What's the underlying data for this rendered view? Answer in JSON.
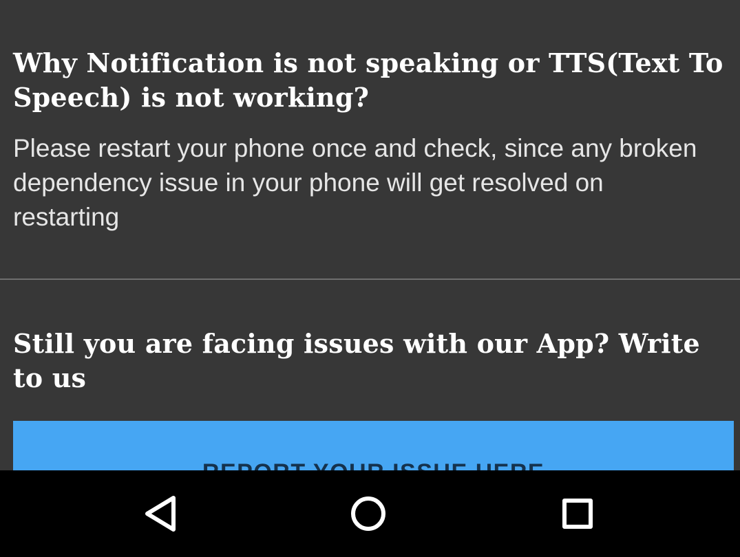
{
  "faq": {
    "question": "Why Notification is not speaking or TTS(Text To Speech) is not working?",
    "answer": "Please restart your phone once and check, since any broken dependency issue in your phone will get resolved on restarting"
  },
  "contact": {
    "heading": "Still you are facing issues with our App? Write to us",
    "button_label": "REPORT YOUR ISSUE HERE"
  },
  "colors": {
    "background": "#373737",
    "button": "#46a6f3",
    "navbar": "#000000"
  },
  "navbar": {
    "icons": [
      "back-icon",
      "home-icon",
      "recents-icon"
    ]
  }
}
